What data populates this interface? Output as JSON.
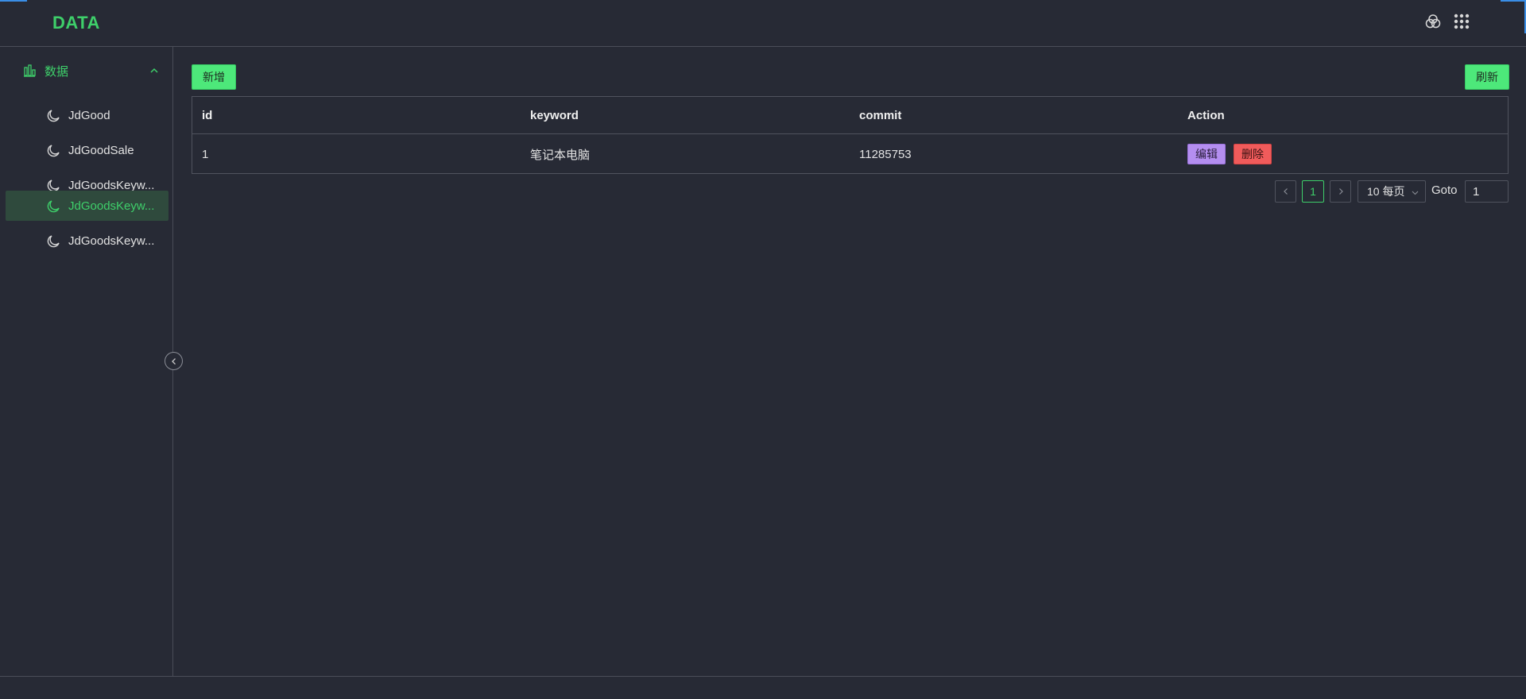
{
  "header": {
    "logo": "DATA"
  },
  "sidebar": {
    "group_label": "数据",
    "items": [
      {
        "label": "JdGood"
      },
      {
        "label": "JdGoodSale"
      },
      {
        "label": "JdGoodsKeyw..."
      },
      {
        "label": "JdGoodsKeyw..."
      },
      {
        "label": "JdGoodsKeyw..."
      }
    ],
    "active_index": 3
  },
  "toolbar": {
    "add_label": "新增",
    "refresh_label": "刷新"
  },
  "table": {
    "columns": [
      "id",
      "keyword",
      "commit",
      "Action"
    ],
    "rows": [
      {
        "id": "1",
        "keyword": "笔记本电脑",
        "commit": "11285753",
        "edit": "编辑",
        "delete": "删除"
      }
    ]
  },
  "pagination": {
    "current_page": "1",
    "page_size": "10 每页",
    "goto_label": "Goto",
    "goto_value": "1"
  },
  "colors": {
    "accent": "#3ecf6a",
    "background": "#272a35",
    "edit": "#b48ef0",
    "delete": "#f05b5b"
  }
}
